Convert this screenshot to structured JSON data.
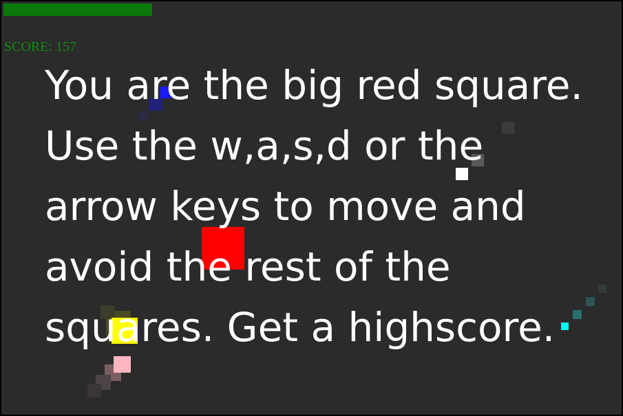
{
  "hud": {
    "score_label": "SCORE:",
    "score_value": "157",
    "health_fraction": 0.24,
    "health_color": "#0b7a0b",
    "score_color": "#128a12"
  },
  "player": {
    "description": "big red square",
    "color": "#ff0000"
  },
  "enemies": [
    {
      "name": "blue",
      "color": "#1a1aff"
    },
    {
      "name": "white",
      "color": "#ffffff"
    },
    {
      "name": "yellow",
      "color": "#ffff00"
    },
    {
      "name": "pink",
      "color": "#ffb6c1"
    },
    {
      "name": "cyan",
      "color": "#00ffff"
    }
  ],
  "instructions": {
    "line1": "You are the big red square.",
    "line2": "Use the w,a,s,d or the",
    "line3": "arrow keys to move and",
    "line4": "avoid the rest of the",
    "line5": "squares. Get a highscore."
  },
  "background_color": "#2b2b2b"
}
